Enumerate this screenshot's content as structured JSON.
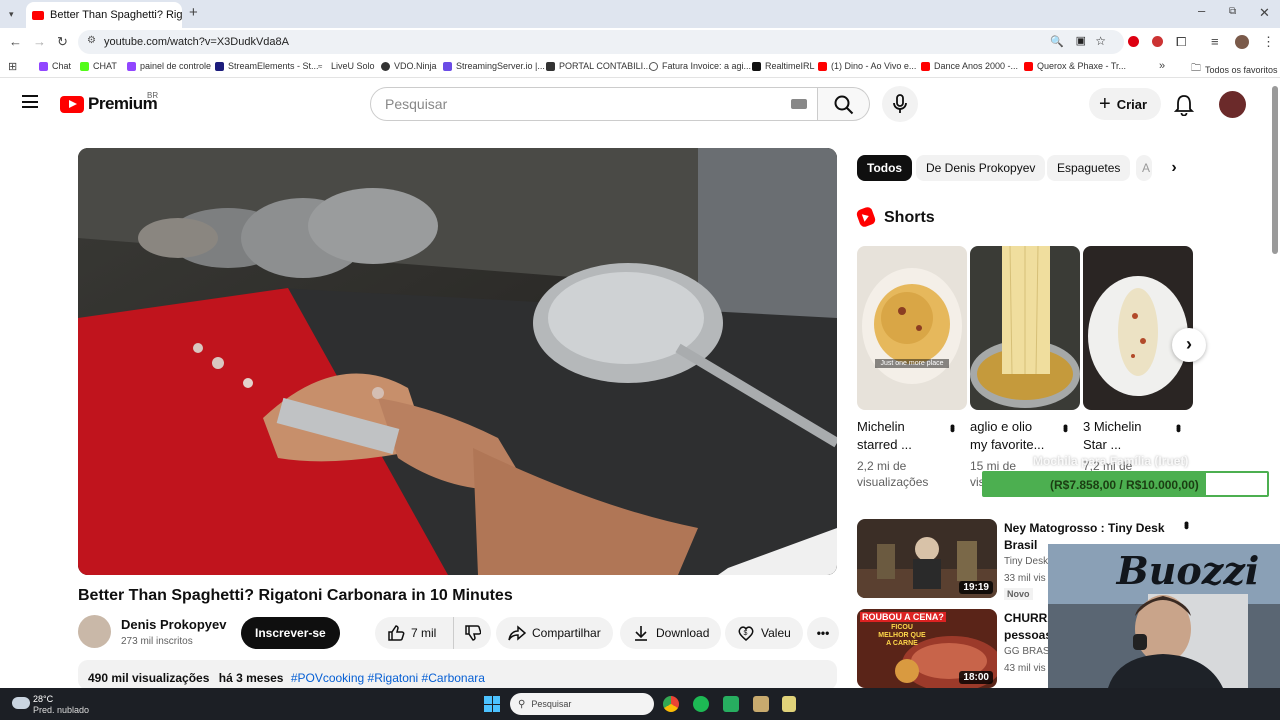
{
  "browser": {
    "tab_title": "Better Than Spaghetti? Rig",
    "url": "youtube.com/watch?v=X3DudkVda8A",
    "bookmarks": [
      "Chat",
      "CHAT",
      "painel de controle",
      "StreamElements - St...",
      "LiveU Solo",
      "VDO.Ninja",
      "StreamingServer.io |...",
      "PORTAL CONTABILI...",
      "Fatura Invoice: a agi...",
      "RealtimeIRL",
      "(1) Dino - Ao Vivo e...",
      "Dance Anos 2000 -...",
      "Querox & Phaxe - Tr..."
    ],
    "all_favorites": "Todos os favoritos"
  },
  "youtube": {
    "logo": "Premium",
    "region": "BR",
    "search_placeholder": "Pesquisar",
    "create_label": "Criar"
  },
  "video": {
    "title": "Better Than Spaghetti? Rigatoni Carbonara in 10 Minutes",
    "channel": "Denis Prokopyev",
    "subscribers": "273 mil inscritos",
    "subscribe_label": "Inscrever-se",
    "likes": "7 mil",
    "share_label": "Compartilhar",
    "download_label": "Download",
    "thanks_label": "Valeu",
    "views": "490 mil visualizações",
    "age": "há 3 meses",
    "hashtags": "#POVcooking #Rigatoni #Carbonara"
  },
  "chips": [
    "Todos",
    "De Denis Prokopyev",
    "Espaguetes",
    "A"
  ],
  "shorts": {
    "heading": "Shorts",
    "items": [
      {
        "title1": "Michelin",
        "title2": "starred ...",
        "views1": "2,2 mi de",
        "views2": "visualizações",
        "caption": "Just one more place"
      },
      {
        "title1": "aglio e olio",
        "title2": "my favorite...",
        "views1": "15 mi de",
        "views2": "vis"
      },
      {
        "title1": "3 Michelin",
        "title2": "Star ...",
        "views1": "7,2 mi de",
        "views2": ""
      }
    ]
  },
  "overlay": {
    "goal_label": "Mochila para Família (Iruet)",
    "goal_amount": "(R$7.858,00 / R$10.000,00)",
    "goal_fraction": 0.7858,
    "webcam_text": "Buozzi"
  },
  "recommendations": [
    {
      "title1": "Ney Matogrosso : Tiny Desk",
      "title2": "Brasil",
      "channel": "Tiny Desk",
      "views": "33 mil vis",
      "badge": "Novo",
      "duration": "19:19"
    },
    {
      "title1": "CHURRA",
      "title2": "pessoas",
      "channel": "GG BRASA",
      "views": "43 mil vis",
      "duration": "18:00",
      "thumb_text1": "ROUBOU A CENA?",
      "thumb_text2": "FICOU MELHOR QUE A CARNE"
    }
  ],
  "taskbar": {
    "temperature": "28°C",
    "weather": "Pred. nublado",
    "search_label": "Pesquisar"
  }
}
